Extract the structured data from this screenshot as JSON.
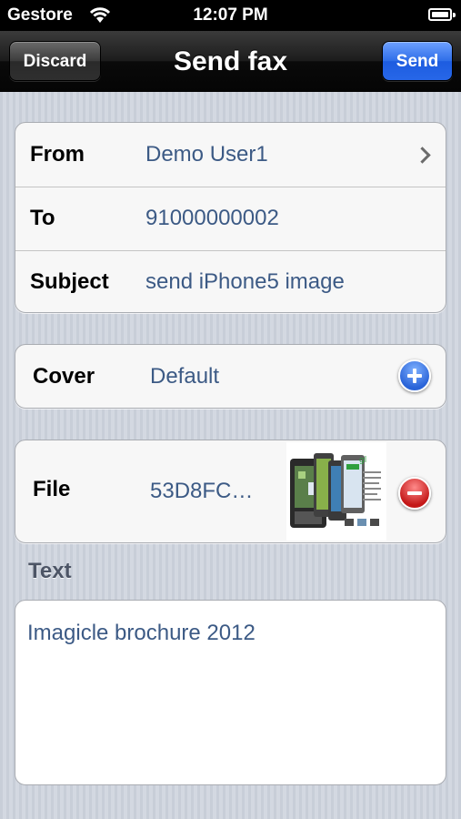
{
  "status_bar": {
    "carrier": "Gestore",
    "time": "12:07 PM",
    "icons": [
      "wifi-icon",
      "battery-icon"
    ]
  },
  "nav": {
    "title": "Send fax",
    "discard_label": "Discard",
    "send_label": "Send",
    "send_color": "#2e6ee8"
  },
  "fax_fields": [
    {
      "label": "From",
      "value": "Demo User1"
    },
    {
      "label": "To",
      "value": "91000000002"
    },
    {
      "label": "Subject",
      "value": "send iPhone5 image"
    }
  ],
  "cover": {
    "label": "Cover",
    "value": "Default",
    "icon": "add-icon"
  },
  "file": {
    "label": "File",
    "value": "53D8FC…",
    "icon": "remove-icon",
    "thumbnail": "phone-brochure-thumbnail"
  },
  "text_section": {
    "header": "Text",
    "content": "Imagicle brochure 2012"
  },
  "colors": {
    "value_text": "#3c5a85",
    "add": "#2a64d8",
    "remove": "#c41818"
  }
}
